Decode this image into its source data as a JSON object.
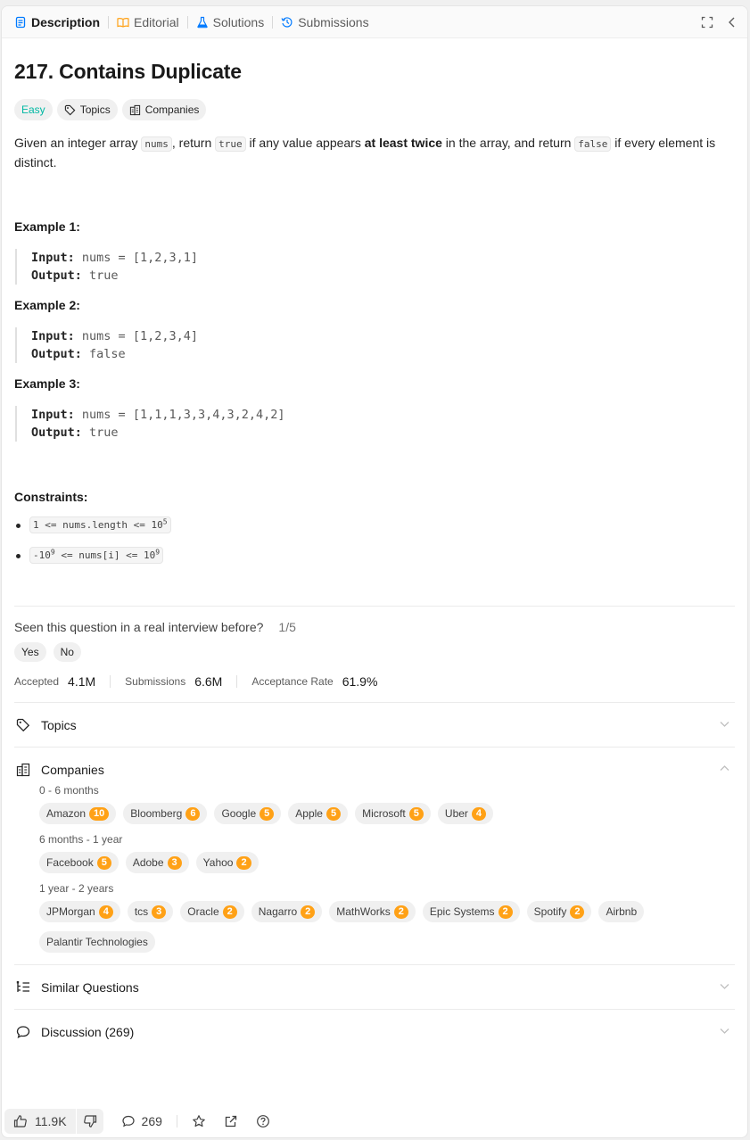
{
  "tabs": [
    {
      "label": "Description",
      "icon": "description-icon",
      "active": true
    },
    {
      "label": "Editorial",
      "icon": "book-icon"
    },
    {
      "label": "Solutions",
      "icon": "flask-icon"
    },
    {
      "label": "Submissions",
      "icon": "history-icon"
    }
  ],
  "problem": {
    "title": "217. Contains Duplicate",
    "difficulty": "Easy",
    "topics_label": "Topics",
    "companies_label": "Companies",
    "desc": {
      "p1": "Given an integer array ",
      "c1": "nums",
      "p2": ", return ",
      "c2": "true",
      "p3": " if any value appears ",
      "bold": "at least twice",
      "p4": " in the array, and return ",
      "c3": "false",
      "p5": " if every element is distinct."
    }
  },
  "examples": [
    {
      "title": "Example 1:",
      "input_label": "Input:",
      "input": "nums = [1,2,3,1]",
      "output_label": "Output:",
      "output": "true"
    },
    {
      "title": "Example 2:",
      "input_label": "Input:",
      "input": "nums = [1,2,3,4]",
      "output_label": "Output:",
      "output": "false"
    },
    {
      "title": "Example 3:",
      "input_label": "Input:",
      "input": "nums = [1,1,1,3,3,4,3,2,4,2]",
      "output_label": "Output:",
      "output": "true"
    }
  ],
  "constraints": {
    "title": "Constraints:",
    "c1": {
      "text": "1 <= nums.length <= 10",
      "sup": "5"
    },
    "c2": {
      "pre": "-10",
      "pre_sup": "9",
      "mid": " <= nums[i] <= 10",
      "sup": "9"
    }
  },
  "interview": {
    "question": "Seen this question in a real interview before?",
    "count": "1/5",
    "yes": "Yes",
    "no": "No"
  },
  "stats": {
    "accepted_label": "Accepted",
    "accepted": "4.1M",
    "submissions_label": "Submissions",
    "submissions": "6.6M",
    "rate_label": "Acceptance Rate",
    "rate": "61.9%"
  },
  "sections": {
    "topics": "Topics",
    "companies": "Companies",
    "similar": "Similar Questions",
    "discussion": "Discussion (269)"
  },
  "company_groups": [
    {
      "label": "0 - 6 months",
      "items": [
        {
          "name": "Amazon",
          "n": "10"
        },
        {
          "name": "Bloomberg",
          "n": "6"
        },
        {
          "name": "Google",
          "n": "5"
        },
        {
          "name": "Apple",
          "n": "5"
        },
        {
          "name": "Microsoft",
          "n": "5"
        },
        {
          "name": "Uber",
          "n": "4"
        }
      ]
    },
    {
      "label": "6 months - 1 year",
      "items": [
        {
          "name": "Facebook",
          "n": "5"
        },
        {
          "name": "Adobe",
          "n": "3"
        },
        {
          "name": "Yahoo",
          "n": "2"
        }
      ]
    },
    {
      "label": "1 year - 2 years",
      "items": [
        {
          "name": "JPMorgan",
          "n": "4"
        },
        {
          "name": "tcs",
          "n": "3"
        },
        {
          "name": "Oracle",
          "n": "2"
        },
        {
          "name": "Nagarro",
          "n": "2"
        },
        {
          "name": "MathWorks",
          "n": "2"
        },
        {
          "name": "Epic Systems",
          "n": "2"
        },
        {
          "name": "Spotify",
          "n": "2"
        },
        {
          "name": "Airbnb",
          "n": ""
        },
        {
          "name": "Palantir Technologies",
          "n": ""
        }
      ]
    }
  ],
  "footer": {
    "likes": "11.9K",
    "comments": "269"
  },
  "colors": {
    "easy": "#00b8a3",
    "count_badge": "#ffa116",
    "active_tab_icon": "#007aff"
  }
}
